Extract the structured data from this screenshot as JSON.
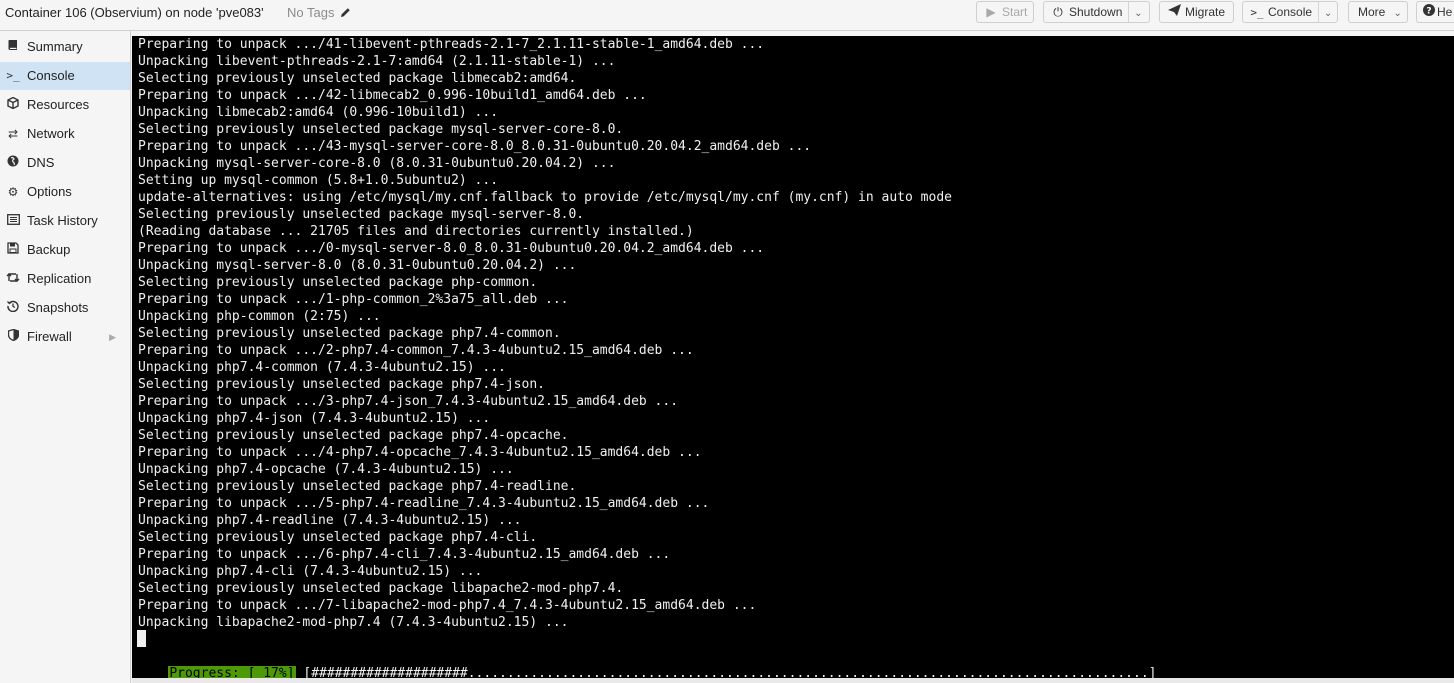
{
  "header": {
    "title": "Container 106 (Observium) on node 'pve083'",
    "tags_label": "No Tags"
  },
  "toolbar": {
    "start_label": "Start",
    "shutdown_label": "Shutdown",
    "migrate_label": "Migrate",
    "console_label": "Console",
    "more_label": "More",
    "help_label": "He"
  },
  "sidebar": {
    "items": [
      {
        "label": "Summary",
        "icon": "book-icon"
      },
      {
        "label": "Console",
        "icon": "terminal-icon",
        "active": true
      },
      {
        "label": "Resources",
        "icon": "cube-icon"
      },
      {
        "label": "Network",
        "icon": "exchange-icon"
      },
      {
        "label": "DNS",
        "icon": "globe-icon"
      },
      {
        "label": "Options",
        "icon": "gear-icon"
      },
      {
        "label": "Task History",
        "icon": "list-icon"
      },
      {
        "label": "Backup",
        "icon": "floppy-icon"
      },
      {
        "label": "Replication",
        "icon": "retweet-icon"
      },
      {
        "label": "Snapshots",
        "icon": "history-icon"
      },
      {
        "label": "Firewall",
        "icon": "shield-icon",
        "expandable": true
      }
    ]
  },
  "terminal": {
    "lines": [
      "Preparing to unpack .../41-libevent-pthreads-2.1-7_2.1.11-stable-1_amd64.deb ...",
      "Unpacking libevent-pthreads-2.1-7:amd64 (2.1.11-stable-1) ...",
      "Selecting previously unselected package libmecab2:amd64.",
      "Preparing to unpack .../42-libmecab2_0.996-10build1_amd64.deb ...",
      "Unpacking libmecab2:amd64 (0.996-10build1) ...",
      "Selecting previously unselected package mysql-server-core-8.0.",
      "Preparing to unpack .../43-mysql-server-core-8.0_8.0.31-0ubuntu0.20.04.2_amd64.deb ...",
      "Unpacking mysql-server-core-8.0 (8.0.31-0ubuntu0.20.04.2) ...",
      "Setting up mysql-common (5.8+1.0.5ubuntu2) ...",
      "update-alternatives: using /etc/mysql/my.cnf.fallback to provide /etc/mysql/my.cnf (my.cnf) in auto mode",
      "Selecting previously unselected package mysql-server-8.0.",
      "(Reading database ... 21705 files and directories currently installed.)",
      "Preparing to unpack .../0-mysql-server-8.0_8.0.31-0ubuntu0.20.04.2_amd64.deb ...",
      "Unpacking mysql-server-8.0 (8.0.31-0ubuntu0.20.04.2) ...",
      "Selecting previously unselected package php-common.",
      "Preparing to unpack .../1-php-common_2%3a75_all.deb ...",
      "Unpacking php-common (2:75) ...",
      "Selecting previously unselected package php7.4-common.",
      "Preparing to unpack .../2-php7.4-common_7.4.3-4ubuntu2.15_amd64.deb ...",
      "Unpacking php7.4-common (7.4.3-4ubuntu2.15) ...",
      "Selecting previously unselected package php7.4-json.",
      "Preparing to unpack .../3-php7.4-json_7.4.3-4ubuntu2.15_amd64.deb ...",
      "Unpacking php7.4-json (7.4.3-4ubuntu2.15) ...",
      "Selecting previously unselected package php7.4-opcache.",
      "Preparing to unpack .../4-php7.4-opcache_7.4.3-4ubuntu2.15_amd64.deb ...",
      "Unpacking php7.4-opcache (7.4.3-4ubuntu2.15) ...",
      "Selecting previously unselected package php7.4-readline.",
      "Preparing to unpack .../5-php7.4-readline_7.4.3-4ubuntu2.15_amd64.deb ...",
      "Unpacking php7.4-readline (7.4.3-4ubuntu2.15) ...",
      "Selecting previously unselected package php7.4-cli.",
      "Preparing to unpack .../6-php7.4-cli_7.4.3-4ubuntu2.15_amd64.deb ...",
      "Unpacking php7.4-cli (7.4.3-4ubuntu2.15) ...",
      "Selecting previously unselected package libapache2-mod-php7.4.",
      "Preparing to unpack .../7-libapache2-mod-php7.4_7.4.3-4ubuntu2.15_amd64.deb ...",
      "Unpacking libapache2-mod-php7.4 (7.4.3-4ubuntu2.15) ..."
    ],
    "progress_label": "Progress: [ 17%]",
    "progress_bar": "[####################.......................................................................................]",
    "progress_percent": 17,
    "progress_color": "#4e9a06"
  }
}
